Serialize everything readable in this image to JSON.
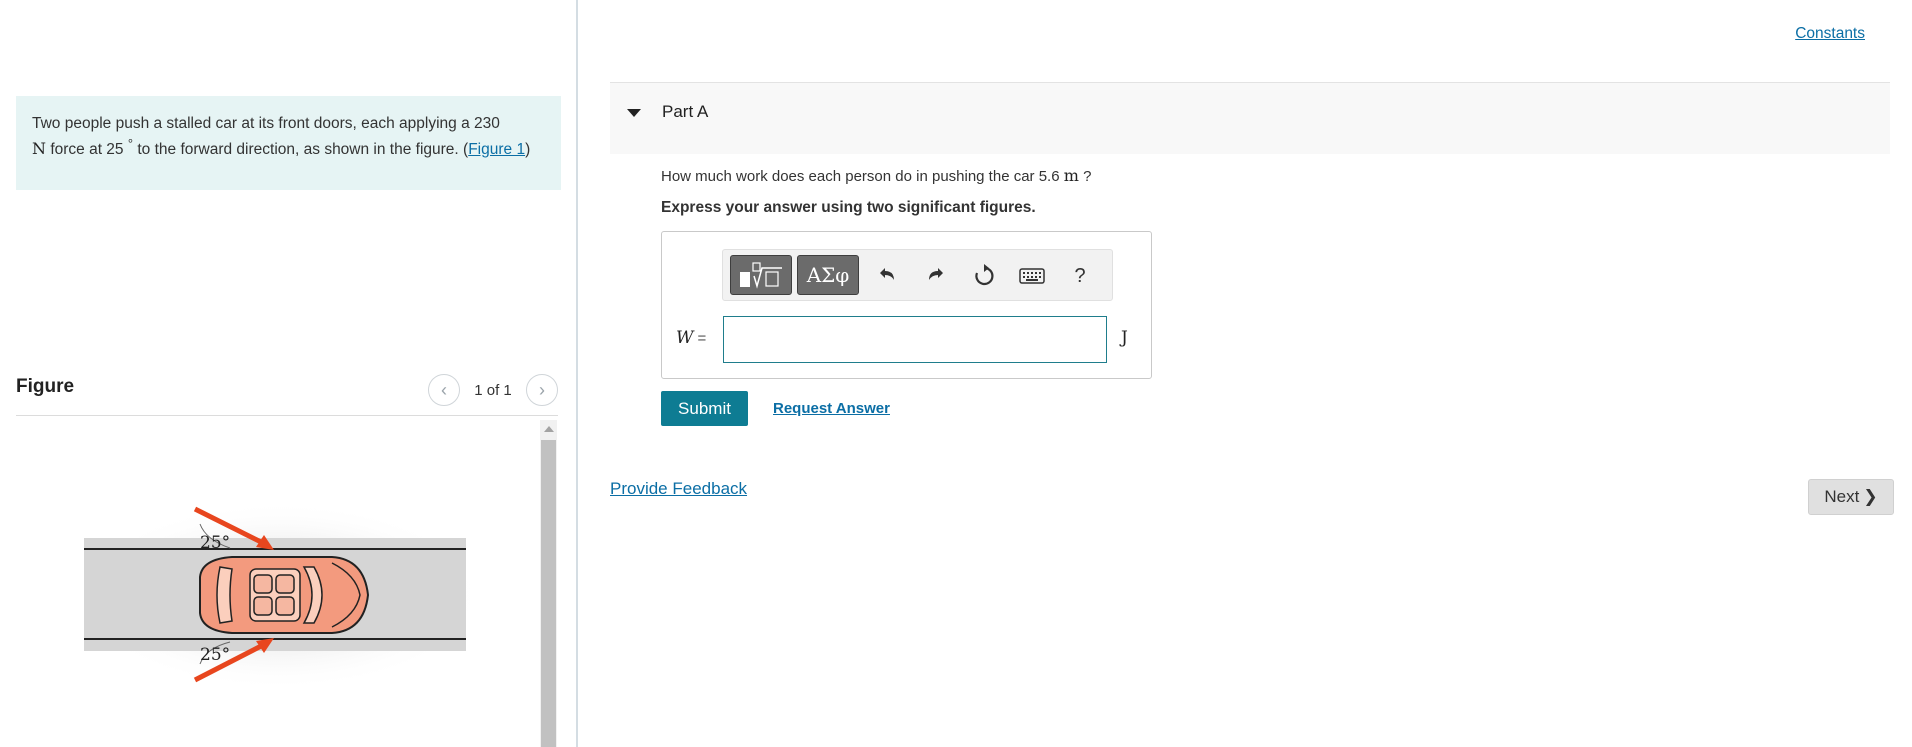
{
  "problem": {
    "text_before_n": "Two people push a stalled car at its front doors, each applying a 230",
    "unit_n": "N",
    "text_force": "force at 25",
    "degree_symbol": "°",
    "text_after": "to the forward direction, as shown in the figure. (",
    "figure_link": "Figure 1",
    "close_paren": ")"
  },
  "figure_panel": {
    "heading": "Figure",
    "prev_icon": "chevron-left-icon",
    "next_icon": "chevron-right-icon",
    "counter": "1 of 1",
    "angle_top": "25°",
    "angle_bottom": "25°",
    "arrow_color": "#e8461e",
    "car_color": "#f39a7e"
  },
  "header": {
    "constants_link": "Constants"
  },
  "part_a": {
    "title": "Part A",
    "question_before": "How much work does each person do in pushing the car 5.6",
    "question_unit": "m",
    "question_after": "?",
    "instruction": "Express your answer using two significant figures."
  },
  "answer": {
    "variable": "W",
    "equals": "=",
    "value": "",
    "unit": "J",
    "toolbar": {
      "templates_icon": "templates-icon",
      "symbols_label": "ΑΣφ",
      "undo_icon": "undo-icon",
      "redo_icon": "redo-icon",
      "reset_icon": "reset-icon",
      "keyboard_icon": "keyboard-icon",
      "help_label": "?"
    }
  },
  "actions": {
    "submit": "Submit",
    "request_answer": "Request Answer",
    "provide_feedback": "Provide Feedback",
    "next": "Next"
  }
}
